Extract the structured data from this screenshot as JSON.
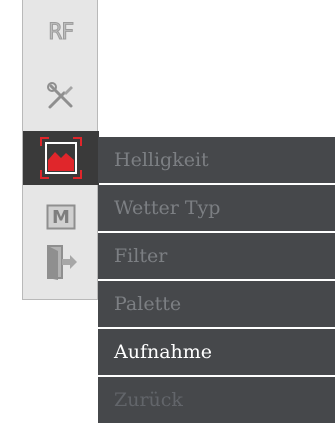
{
  "toolbar": {
    "tools": [
      {
        "name": "rf-icon",
        "label": "RF"
      },
      {
        "name": "tools-icon"
      },
      {
        "name": "image-capture-icon"
      },
      {
        "name": "m-icon",
        "label": "M"
      },
      {
        "name": "exit-icon"
      }
    ],
    "active_index": 2
  },
  "menu": {
    "items": [
      {
        "label": "Helligkeit"
      },
      {
        "label": "Wetter Typ"
      },
      {
        "label": "Filter"
      },
      {
        "label": "Palette"
      },
      {
        "label": "Aufnahme"
      },
      {
        "label": "Zurück"
      }
    ],
    "selected_index": 4
  },
  "colors": {
    "menu_bg": "#46484b",
    "menu_text": "#7c7f83",
    "menu_text_selected": "#ffffff",
    "toolbar_bg": "#e6e6e6",
    "toolbar_active_bg": "#3a3a3a",
    "accent_red": "#e0262b"
  }
}
